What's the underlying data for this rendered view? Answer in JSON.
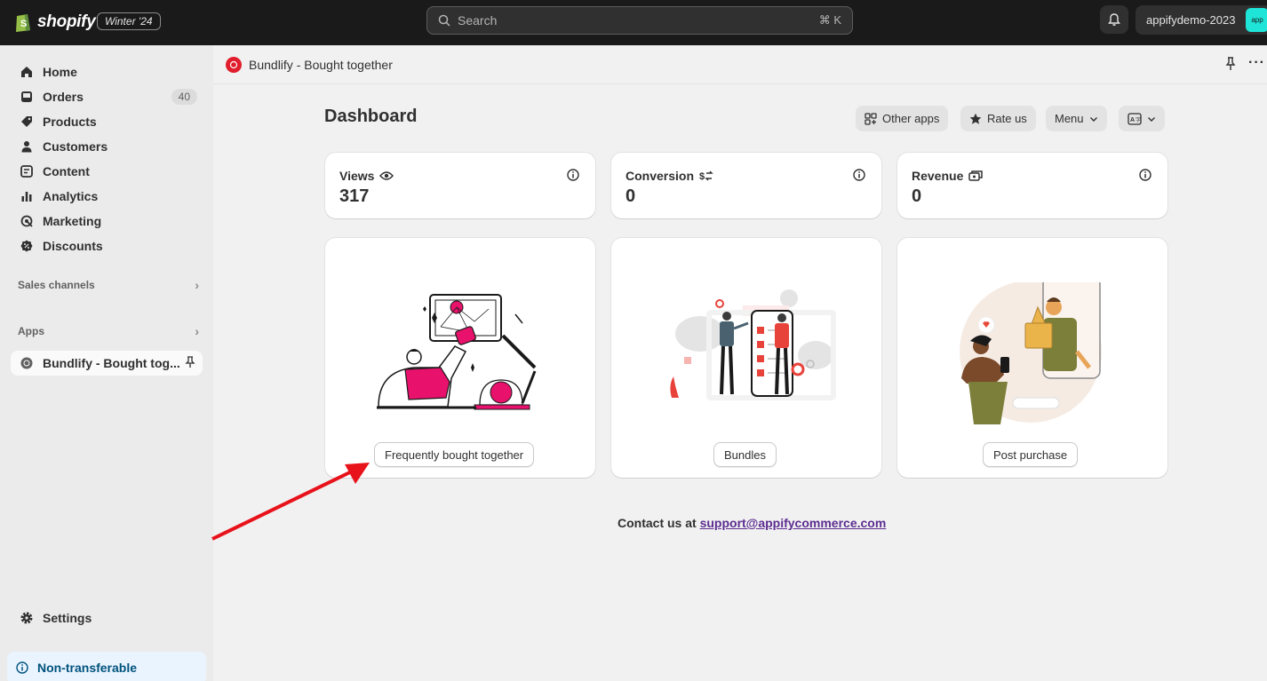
{
  "topbar": {
    "brand": "shopify",
    "edition_badge": "Winter '24",
    "search_placeholder": "Search",
    "search_shortcut": "⌘ K",
    "store_name": "appifydemo-2023",
    "store_avatar_text": "app",
    "accent_color": "#1ee5d8"
  },
  "sidebar": {
    "items": [
      {
        "label": "Home",
        "icon": "home-icon"
      },
      {
        "label": "Orders",
        "icon": "inbox-icon",
        "badge": "40"
      },
      {
        "label": "Products",
        "icon": "tag-icon"
      },
      {
        "label": "Customers",
        "icon": "person-icon"
      },
      {
        "label": "Content",
        "icon": "content-icon"
      },
      {
        "label": "Analytics",
        "icon": "bar-chart-icon"
      },
      {
        "label": "Marketing",
        "icon": "target-icon"
      },
      {
        "label": "Discounts",
        "icon": "discount-icon"
      }
    ],
    "sales_channels": "Sales channels",
    "apps": "Apps",
    "active_app": "Bundlify - Bought tog...",
    "settings": "Settings",
    "notice": "Non-transferable"
  },
  "app_header": {
    "title": "Bundlify - Bought together"
  },
  "dashboard": {
    "title": "Dashboard",
    "buttons": {
      "other_apps": "Other apps",
      "rate_us": "Rate us",
      "menu": "Menu"
    },
    "stats": [
      {
        "label": "Views",
        "value": "317"
      },
      {
        "label": "Conversion",
        "value": "0"
      },
      {
        "label": "Revenue",
        "value": "0"
      }
    ],
    "features": [
      {
        "label": "Frequently bought together"
      },
      {
        "label": "Bundles"
      },
      {
        "label": "Post purchase"
      }
    ],
    "contact_prefix": "Contact us at",
    "contact_email": "support@appifycommerce.com"
  }
}
